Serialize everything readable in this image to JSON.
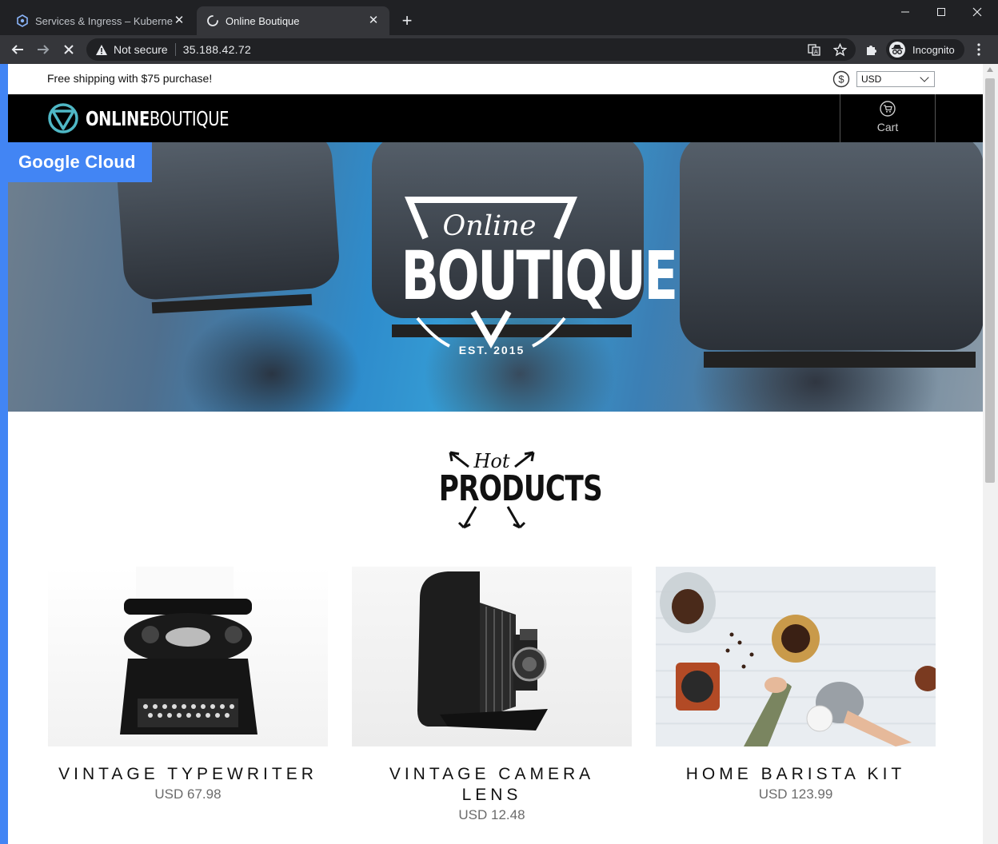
{
  "browser": {
    "tabs": [
      {
        "title": "Services & Ingress – Kubernete",
        "active": false,
        "icon": "kubernetes-icon"
      },
      {
        "title": "Online Boutique",
        "active": true,
        "icon": "loading-spinner-icon"
      }
    ],
    "address": {
      "security_label": "Not secure",
      "url": "35.188.42.72"
    },
    "profile_label": "Incognito"
  },
  "page": {
    "banner": {
      "shipping_text": "Free shipping with $75 purchase!",
      "currency": "USD"
    },
    "header": {
      "brand_bold": "ONLINE",
      "brand_light": "BOUTIQUE",
      "cart_label": "Cart"
    },
    "badge": "Google Cloud",
    "hero": {
      "line1": "Online",
      "line2": "BOUTIQUE",
      "est": "EST. 2015"
    },
    "hot_products": {
      "word1": "Hot",
      "word2": "PRODUCTS"
    },
    "products": [
      {
        "name": "VINTAGE TYPEWRITER",
        "price": "USD 67.98"
      },
      {
        "name": "VINTAGE CAMERA LENS",
        "price": "USD 12.48"
      },
      {
        "name": "HOME BARISTA KIT",
        "price": "USD 123.99"
      }
    ]
  },
  "colors": {
    "accent": "#4285f4",
    "header_bg": "#000000",
    "chrome_dark": "#202124",
    "chrome_toolbar": "#35363a"
  }
}
